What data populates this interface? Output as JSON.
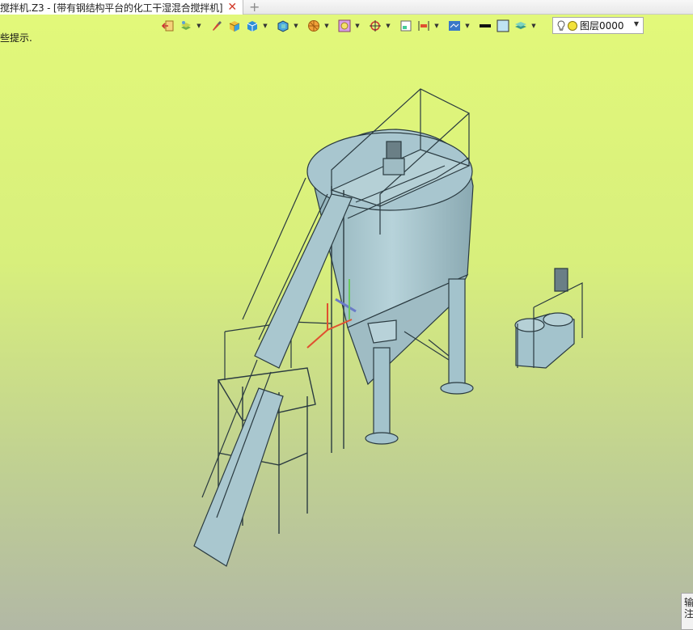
{
  "tab": {
    "title": "搅拌机.Z3 - [带有钢结构平台的化工干湿混合搅拌机]",
    "close_glyph": "✕",
    "new_tab_glyph": "+"
  },
  "hint": {
    "text": "些提示."
  },
  "toolbar": {
    "icons": [
      "exit-icon",
      "layers-icon",
      "brush-icon",
      "solid-box-icon",
      "shaded-box-icon",
      "view-cube-icon",
      "section-icon",
      "display-mode-icon",
      "snap-icon",
      "frame-icon",
      "align-icon",
      "grid-display-icon",
      "line-color-icon",
      "fill-color-icon",
      "plane-stack-icon"
    ],
    "layer_label": "图层0000",
    "dropdown_glyph": "▼"
  },
  "colors": {
    "viewport_top": "#e2f87a",
    "viewport_bottom": "#b2b8a5",
    "model_fill": "#a3c3cc",
    "model_stroke": "#2a3a40"
  },
  "side_panel": {
    "text": "输\n注"
  }
}
